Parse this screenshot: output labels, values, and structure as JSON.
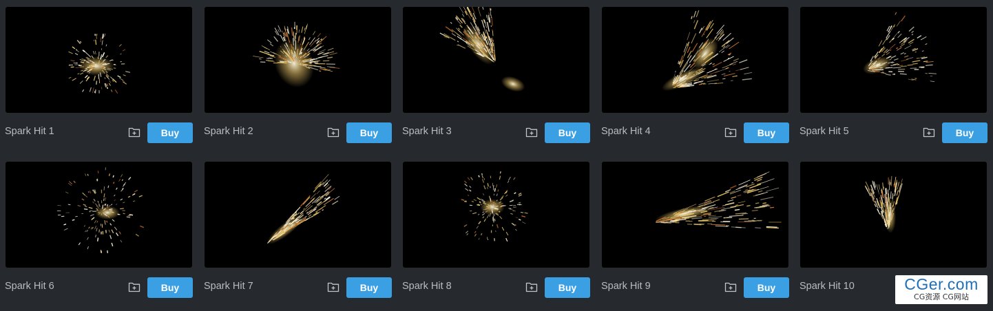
{
  "gallery": {
    "buy_label": "Buy",
    "items": [
      {
        "title": "Spark Hit 1"
      },
      {
        "title": "Spark Hit 2"
      },
      {
        "title": "Spark Hit 3"
      },
      {
        "title": "Spark Hit 4"
      },
      {
        "title": "Spark Hit 5"
      },
      {
        "title": "Spark Hit 6"
      },
      {
        "title": "Spark Hit 7"
      },
      {
        "title": "Spark Hit 8"
      },
      {
        "title": "Spark Hit 9"
      },
      {
        "title": "Spark Hit 10"
      }
    ]
  },
  "icons": {
    "collection": "folder-plus-icon"
  },
  "colors": {
    "background": "#26292d",
    "thumbnail": "#000000",
    "buy_button": "#3aa0e3",
    "title_text": "#b9bcc1",
    "spark_core": "#fff8e0",
    "spark_gold": "#e8c46a"
  },
  "watermark": {
    "main": "CGer.com",
    "sub": "CG资源 CG网站"
  }
}
